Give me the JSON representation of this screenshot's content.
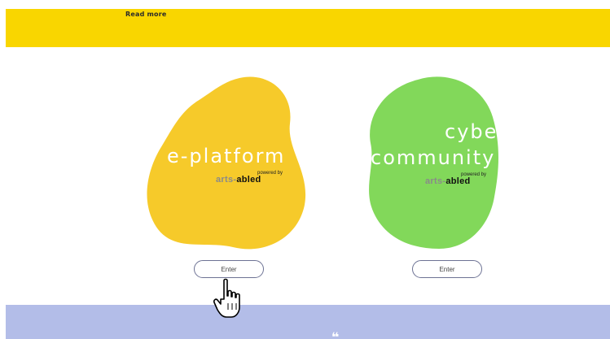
{
  "top_banner": {
    "read_more": "Read more"
  },
  "cards": [
    {
      "title_lines": [
        "e-platform"
      ],
      "powered_by": "powered by",
      "brand_prefix": "arts-",
      "brand_suffix": "abled",
      "button_label": "Enter",
      "color": "#f6ca2a"
    },
    {
      "title_lines": [
        "cyber",
        "community"
      ],
      "powered_by": "powered by",
      "brand_prefix": "arts-",
      "brand_suffix": "abled",
      "button_label": "Enter",
      "color": "#82d85a"
    }
  ],
  "colors": {
    "yellow_band": "#f9d600",
    "blue_band": "#b3bde8",
    "button_border": "#6d7294"
  },
  "icons": {
    "cursor": "hand-pointer-icon"
  }
}
